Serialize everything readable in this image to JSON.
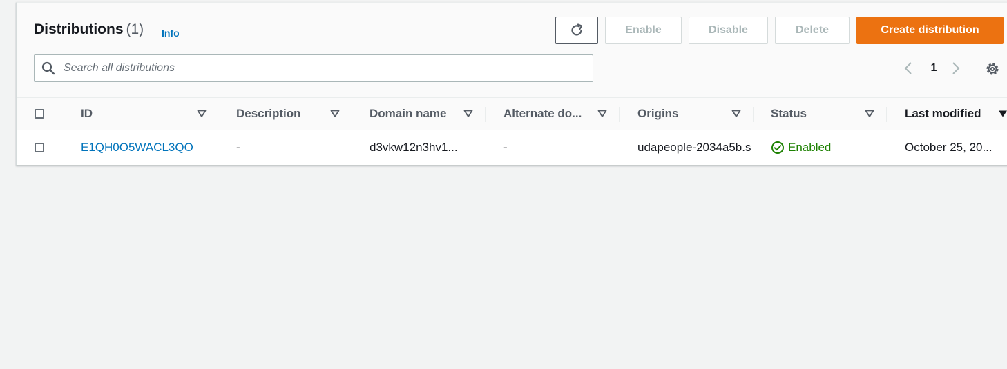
{
  "header": {
    "title": "Distributions",
    "count": "(1)",
    "info_label": "Info"
  },
  "toolbar": {
    "refresh_icon": "refresh-icon",
    "enable_label": "Enable",
    "disable_label": "Disable",
    "delete_label": "Delete",
    "create_label": "Create distribution",
    "create_color": "#ec7211"
  },
  "search": {
    "placeholder": "Search all distributions",
    "value": ""
  },
  "pagination": {
    "current_page": "1"
  },
  "table": {
    "columns": [
      "ID",
      "Description",
      "Domain name",
      "Alternate do...",
      "Origins",
      "Status",
      "Last modified"
    ],
    "sorted_column": "Last modified",
    "rows": [
      {
        "id": "E1QH0O5WACL3QO",
        "description": "-",
        "domain_name": "d3vkw12n3hv1...",
        "alternate_domain": "-",
        "origins": "udapeople-2034a5b.s",
        "status": "Enabled",
        "last_modified": "October 25, 20..."
      }
    ]
  },
  "colors": {
    "link": "#0073bb",
    "status_enabled": "#1d8102",
    "background": "#f2f3f3"
  }
}
